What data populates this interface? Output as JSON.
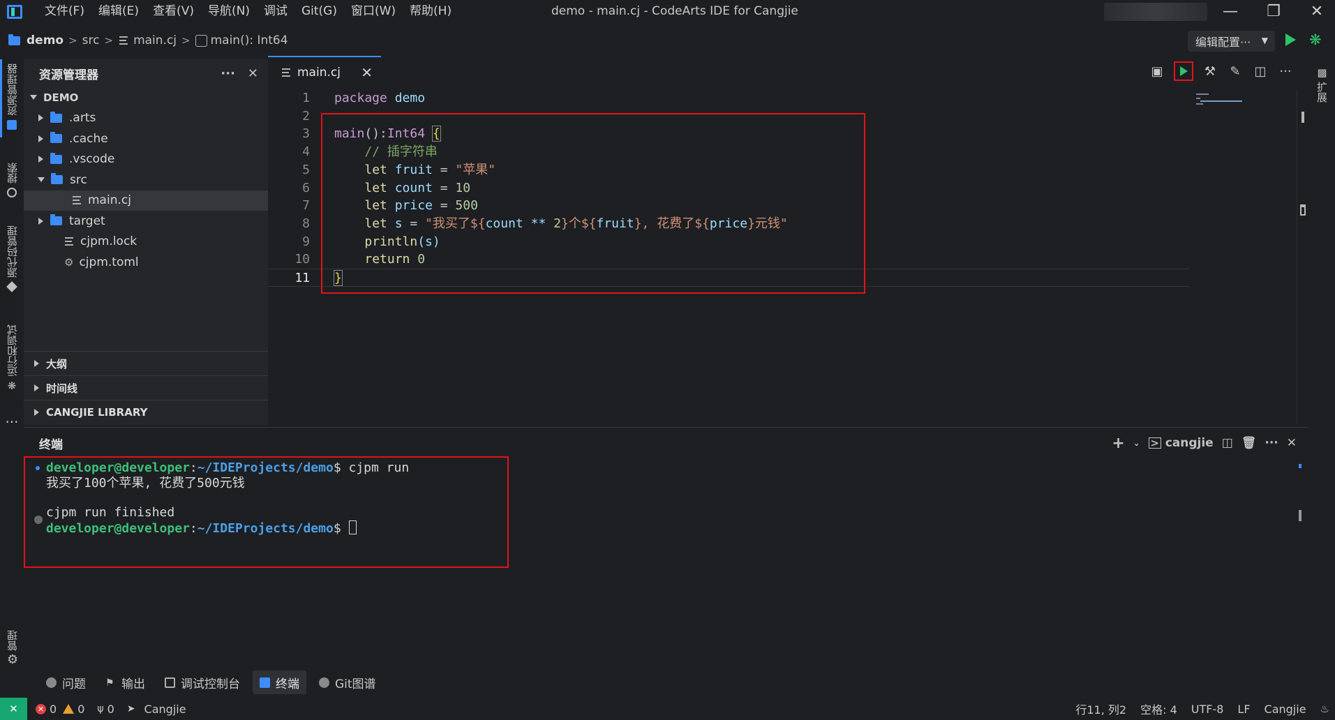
{
  "menu": [
    "文件(F)",
    "编辑(E)",
    "查看(V)",
    "导航(N)",
    "调试",
    "Git(G)",
    "窗口(W)",
    "帮助(H)"
  ],
  "window_title": "demo - main.cj - CodeArts IDE for Cangjie",
  "breadcrumb": {
    "project": "demo",
    "folder": "src",
    "file": "main.cj",
    "symbol": "main(): Int64"
  },
  "run_config": {
    "label": "编辑配置···"
  },
  "activity_bar": {
    "explorer": "资源管理器",
    "search": "搜索",
    "scm": "源代码管理",
    "run_debug": "运行和调试",
    "manage": "管理"
  },
  "right_bar": {
    "label": "扩展"
  },
  "sidebar": {
    "title": "资源管理器",
    "root": "DEMO",
    "items": [
      {
        "label": ".arts",
        "type": "folder"
      },
      {
        "label": ".cache",
        "type": "folder"
      },
      {
        "label": ".vscode",
        "type": "folder"
      },
      {
        "label": "src",
        "type": "folder-open"
      },
      {
        "label": "main.cj",
        "type": "file"
      },
      {
        "label": "target",
        "type": "folder"
      },
      {
        "label": "cjpm.lock",
        "type": "file"
      },
      {
        "label": "cjpm.toml",
        "type": "gear-file"
      }
    ],
    "sections": [
      "大纲",
      "时间线",
      "CANGJIE LIBRARY"
    ]
  },
  "editor": {
    "tab": "main.cj",
    "lines": [
      {
        "n": "1"
      },
      {
        "n": "2"
      },
      {
        "n": "3"
      },
      {
        "n": "4"
      },
      {
        "n": "5"
      },
      {
        "n": "6"
      },
      {
        "n": "7"
      },
      {
        "n": "8"
      },
      {
        "n": "9"
      },
      {
        "n": "10"
      },
      {
        "n": "11"
      }
    ],
    "code": {
      "l1_kw": "package",
      "l1_name": "demo",
      "l3_fn": "main",
      "l3_sig": "():",
      "l3_type": "Int64",
      "l3_brace": "{",
      "l4": "// 插字符串",
      "l5_kw": "let",
      "l5_var": "fruit",
      "l5_eq": " = ",
      "l5_val": "\"苹果\"",
      "l6_kw": "let",
      "l6_var": "count",
      "l6_eq": " = ",
      "l6_val": "10",
      "l7_kw": "let",
      "l7_var": "price",
      "l7_eq": " = ",
      "l7_val": "500",
      "l8_kw": "let",
      "l8_var": "s",
      "l8_eq": " = ",
      "l8_s1": "\"我买了${",
      "l8_e1": "count ** ",
      "l8_n": "2",
      "l8_s2": "}个${",
      "l8_e2": "fruit",
      "l8_s3": "}, 花费了${",
      "l8_e3": "price",
      "l8_s4": "}元钱\"",
      "l9_fn": "println",
      "l9_arg": "(s)",
      "l10_kw": "return",
      "l10_val": "0",
      "l11": "}"
    }
  },
  "panel": {
    "title": "终端",
    "shell": "cangjie",
    "lines": {
      "user": "developer@developer",
      "path": "~/IDEProjects/demo",
      "cmd": "$ cjpm run",
      "out1": "我买了100个苹果, 花费了500元钱",
      "out2": "cjpm run finished",
      "prompt_end": "$ "
    }
  },
  "panel_tabs": [
    "问题",
    "输出",
    "调试控制台",
    "终端",
    "Git图谱"
  ],
  "statusbar": {
    "errors": "0",
    "warnings": "0",
    "ports": "0",
    "language_server": "Cangjie",
    "position": "行11, 列2",
    "indent": "空格: 4",
    "encoding": "UTF-8",
    "eol": "LF",
    "language": "Cangjie"
  },
  "colors": {
    "accent": "#3d8cf7",
    "highlight": "#e0141a",
    "remote": "#16a870"
  }
}
